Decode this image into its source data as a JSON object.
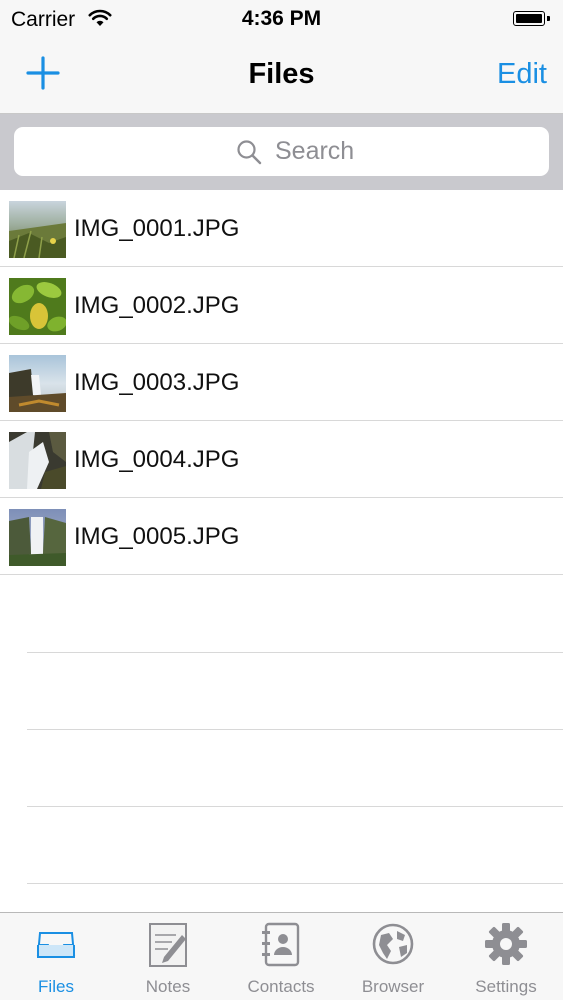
{
  "status": {
    "carrier": "Carrier",
    "time": "4:36 PM"
  },
  "nav": {
    "title": "Files",
    "edit_label": "Edit"
  },
  "search": {
    "placeholder": "Search"
  },
  "files": [
    {
      "name": "IMG_0001.JPG",
      "thumb": "field-grass"
    },
    {
      "name": "IMG_0002.JPG",
      "thumb": "green-leaves"
    },
    {
      "name": "IMG_0003.JPG",
      "thumb": "waterfall-cliff"
    },
    {
      "name": "IMG_0004.JPG",
      "thumb": "waterfall-close"
    },
    {
      "name": "IMG_0005.JPG",
      "thumb": "waterfall-valley"
    }
  ],
  "tabs": [
    {
      "label": "Files",
      "icon": "tray-icon",
      "active": true
    },
    {
      "label": "Notes",
      "icon": "notepad-icon",
      "active": false
    },
    {
      "label": "Contacts",
      "icon": "address-book-icon",
      "active": false
    },
    {
      "label": "Browser",
      "icon": "globe-icon",
      "active": false
    },
    {
      "label": "Settings",
      "icon": "gear-icon",
      "active": false
    }
  ],
  "colors": {
    "accent": "#1a8fe3",
    "inactive": "#8e8e93",
    "bar_background": "#f7f7f7",
    "search_background": "#c9c9ce"
  }
}
